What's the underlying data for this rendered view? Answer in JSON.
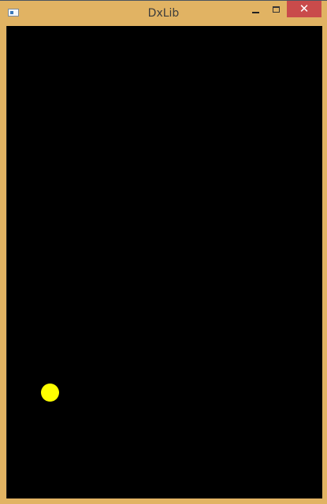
{
  "window": {
    "title": "DxLib",
    "close_glyph": "✕",
    "icons": {
      "app": "window-app-icon",
      "minimize": "minimize-icon",
      "maximize": "maximize-icon",
      "close": "close-icon"
    },
    "colors": {
      "frame": "#e1b363",
      "close_button": "#c94b4b",
      "canvas": "#000000",
      "ball": "#ffff00"
    }
  }
}
